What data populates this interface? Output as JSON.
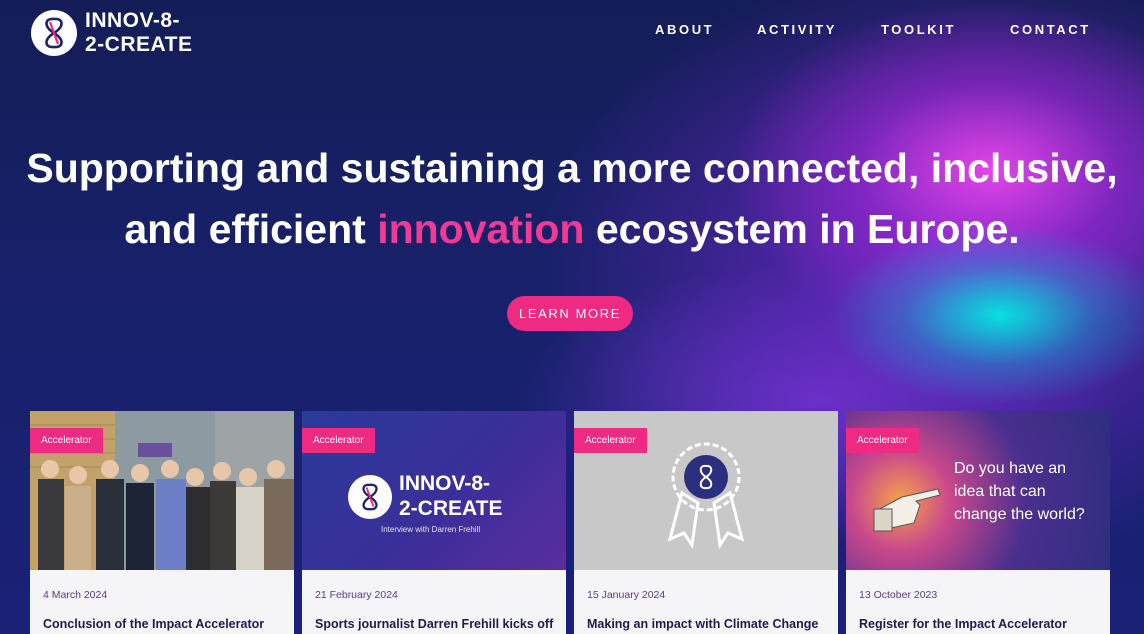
{
  "brand": {
    "name": "INNOV-8-\n2-CREATE",
    "logo_icon": "infinity-8-icon"
  },
  "nav": [
    {
      "label": "ABOUT"
    },
    {
      "label": "ACTIVITY"
    },
    {
      "label": "TOOLKIT"
    },
    {
      "label": "CONTACT"
    }
  ],
  "hero": {
    "line1": "Supporting and sustaining a more connected, inclusive,",
    "line2_before": "and efficient ",
    "line2_highlight": "innovation",
    "line2_after": " ecosystem in Europe.",
    "cta": "LEARN MORE"
  },
  "colors": {
    "accent_pink": "#ee2a83",
    "navy": "#141d57",
    "cyan_glow": "#00ebe1",
    "magenta_glow": "#eb46eb"
  },
  "cards": [
    {
      "badge": "Accelerator",
      "date": "4 March 2024",
      "title": "Conclusion of the Impact Accelerator",
      "image": "group-photo"
    },
    {
      "badge": "Accelerator",
      "date": "21 February 2024",
      "title": "Sports journalist Darren Frehill kicks off",
      "image": "brand-banner",
      "thumb_brand": "INNOV-8-\n2-CREATE",
      "thumb_sub": "Interview with Darren Frehill"
    },
    {
      "badge": "Accelerator",
      "date": "15 January 2024",
      "title": "Making an impact with Climate Change",
      "image": "award-ribbon-icon"
    },
    {
      "badge": "Accelerator",
      "date": "13 October 2023",
      "title": "Register for the Impact Accelerator",
      "image": "pointing-hand",
      "thumb_text": "Do you have an\nidea that can\nchange the world?"
    }
  ]
}
